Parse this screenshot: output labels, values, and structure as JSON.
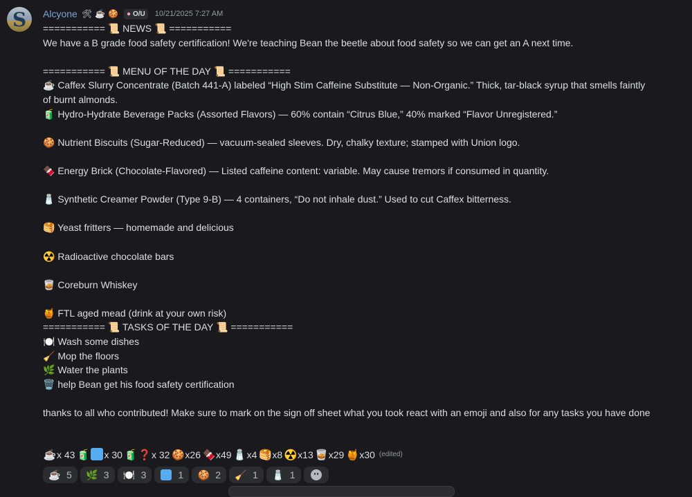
{
  "message": {
    "author": "Alcyone",
    "author_icons": [
      "🛠",
      "☕",
      "🍪"
    ],
    "tag": "O/U",
    "timestamp": "10/21/2025 7:27 AM",
    "lines": [
      {
        "text": "=========== 📜 NEWS 📜 ==========="
      },
      {
        "text": "We have a B grade food safety certification! We're teaching Bean the beetle about food safety so we can get an A next time."
      },
      {
        "text": ""
      },
      {
        "text": "=========== 📜 MENU OF THE DAY 📜 ==========="
      },
      {
        "text": "☕ Caffex Slurry Concentrate (Batch 441-A)  labeled “High Stim Caffeine Substitute — Non-Organic.” Thick, tar-black syrup that smells faintly of burnt almonds."
      },
      {
        "text": "🧃 Hydro-Hydrate Beverage Packs (Assorted Flavors) —  60% contain “Citrus Blue,” 40% marked “Flavor Unregistered.”"
      },
      {
        "text": ""
      },
      {
        "text": "🍪 Nutrient Biscuits (Sugar-Reduced) — vacuum-sealed sleeves. Dry, chalky texture; stamped with Union logo."
      },
      {
        "text": ""
      },
      {
        "text": "🍫 Energy Brick (Chocolate-Flavored) —  Listed caffeine content: variable. May cause tremors if consumed in quantity."
      },
      {
        "text": ""
      },
      {
        "text": "🧂 Synthetic Creamer Powder (Type 9-B) — 4 containers, “Do not inhale dust.” Used to cut Caffex bitterness."
      },
      {
        "text": ""
      },
      {
        "text": "🥞  Yeast fritters  — homemade and delicious"
      },
      {
        "text": ""
      },
      {
        "text": "☢️ Radioactive chocolate bars"
      },
      {
        "text": ""
      },
      {
        "text": "🥃 Coreburn Whiskey"
      },
      {
        "text": ""
      },
      {
        "text": "🍯 FTL aged mead (drink at your own risk)"
      },
      {
        "text": "=========== 📜 TASKS OF THE DAY 📜 ==========="
      },
      {
        "text": "🍽️  Wash some dishes"
      },
      {
        "text": "🧹 Mop the floors"
      },
      {
        "text": "🌿 Water the plants"
      },
      {
        "text": "🗑️ help Bean get his food safety certification"
      },
      {
        "text": ""
      },
      {
        "text": "thanks to all who contributed! Make sure to mark on the sign off sheet what you took react with an emoji and also for any tasks you have done"
      }
    ],
    "tally": [
      {
        "emoji": "☕",
        "count": "x 43"
      },
      {
        "emoji": "🧃",
        "count": ""
      },
      {
        "emoji": "🟦",
        "count": "x 30"
      },
      {
        "emoji": "🧃",
        "count": ""
      },
      {
        "emoji": "❓",
        "count": "x 32"
      },
      {
        "emoji": "🍪",
        "count": "x26"
      },
      {
        "emoji": "🍫",
        "count": "x49"
      },
      {
        "emoji": "🧂",
        "count": "x4"
      },
      {
        "emoji": "🥞",
        "count": "x8"
      },
      {
        "emoji": "☢️",
        "count": "x13"
      },
      {
        "emoji": "🥃",
        "count": "x29"
      },
      {
        "emoji": "🍯",
        "count": "x30"
      }
    ],
    "edited_label": "(edited)"
  },
  "reactions": [
    {
      "emoji": "☕",
      "count": "5"
    },
    {
      "emoji": "🌿",
      "count": "3"
    },
    {
      "emoji": "🍽️",
      "count": "3"
    },
    {
      "emoji": "🟦",
      "count": "1"
    },
    {
      "emoji": "🍪",
      "count": "2"
    },
    {
      "emoji": "🧹",
      "count": "1"
    },
    {
      "emoji": "🧂",
      "count": "1"
    }
  ],
  "add_reaction_icon": "smiley-face-icon"
}
